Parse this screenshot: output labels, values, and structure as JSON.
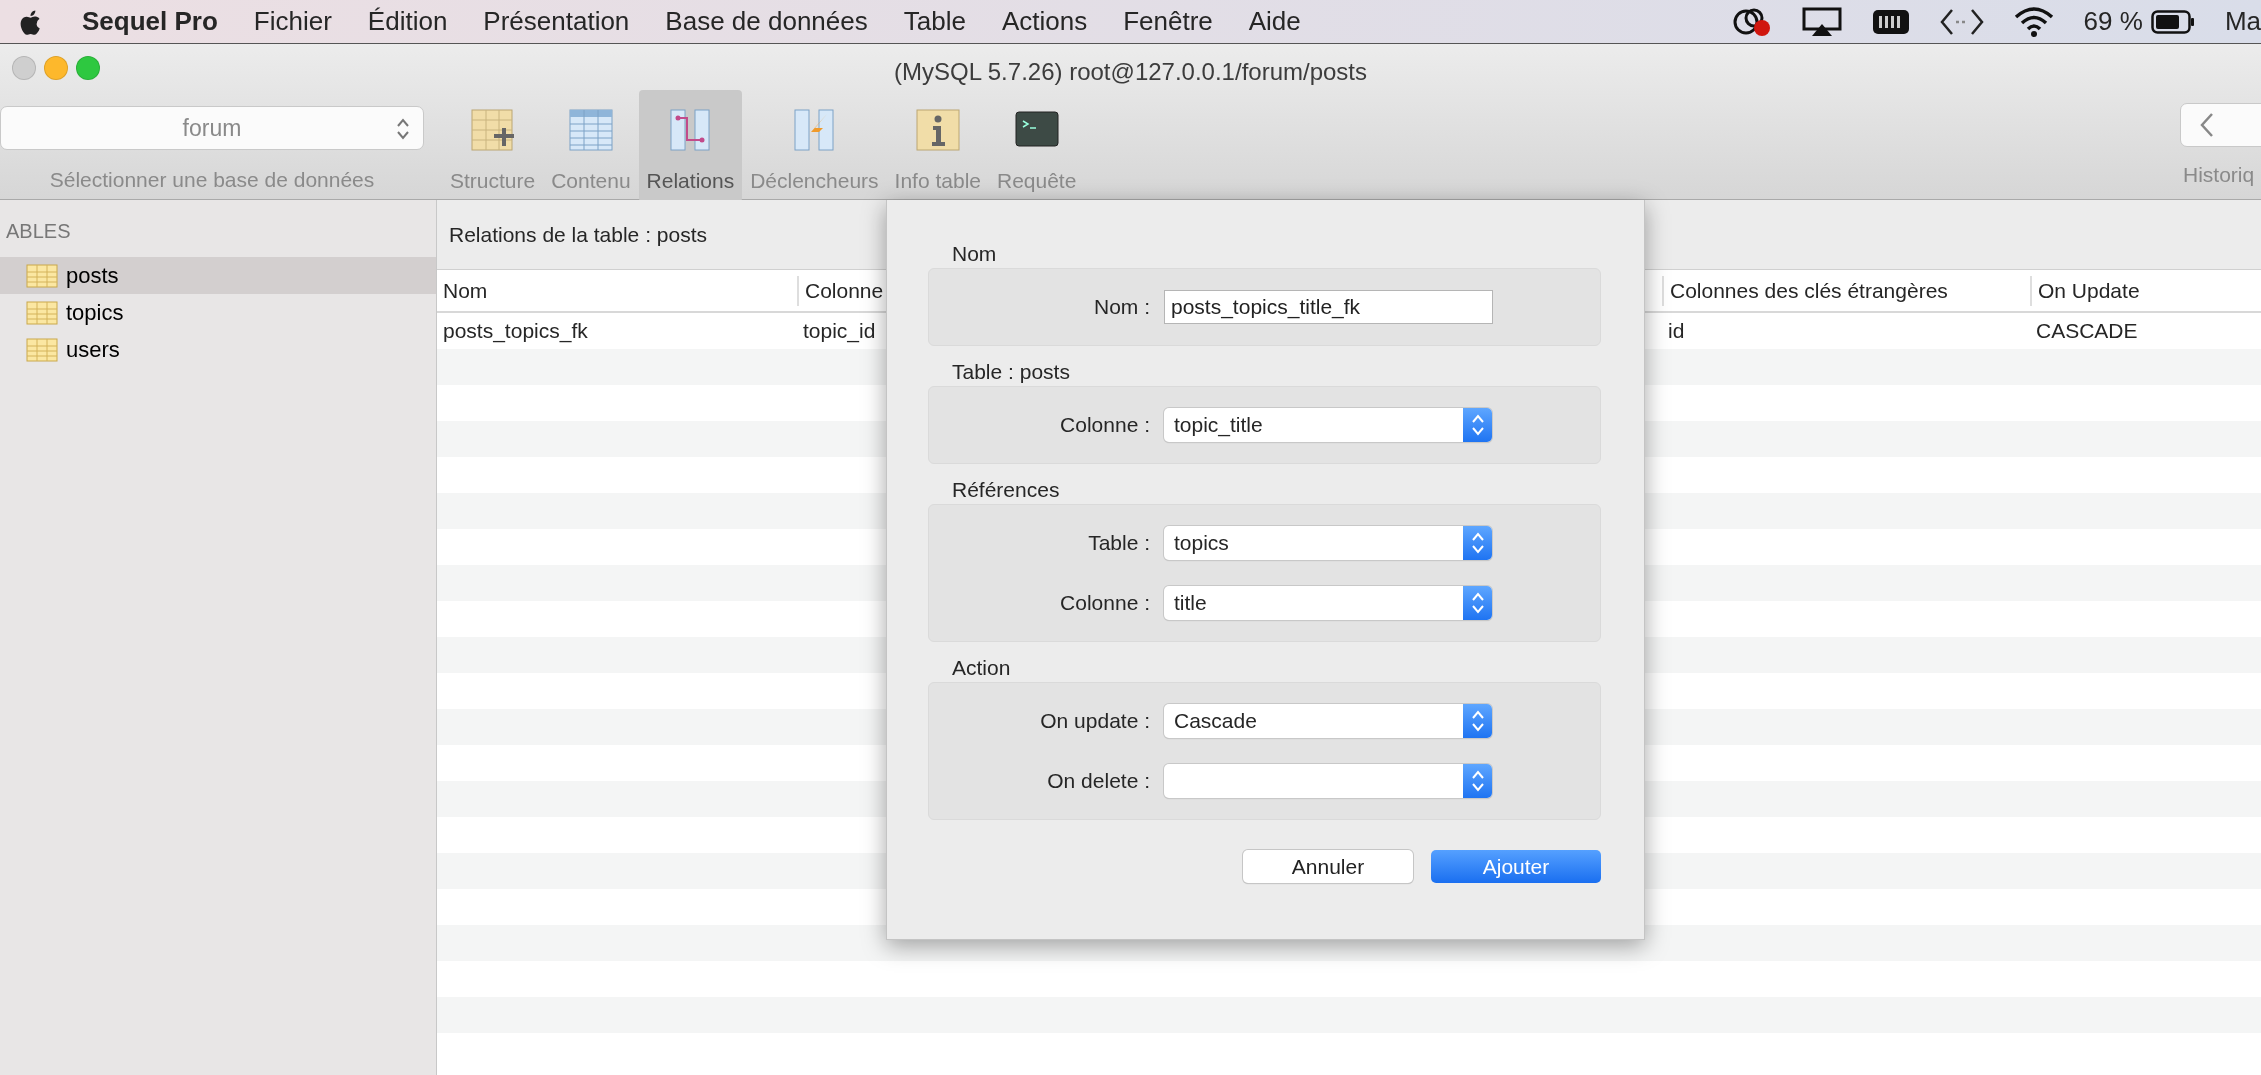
{
  "menu_bar": {
    "app": "Sequel Pro",
    "items": [
      "Fichier",
      "Édition",
      "Présentation",
      "Base de données",
      "Table",
      "Actions",
      "Fenêtre",
      "Aide"
    ],
    "battery": "69 %",
    "clock": "Ma"
  },
  "window": {
    "title": "(MySQL 5.7.26) root@127.0.0.1/forum/posts"
  },
  "toolbar": {
    "database": {
      "value": "forum",
      "label": "Sélectionner une base de données"
    },
    "tabs": [
      {
        "label": "Structure",
        "kind": "structure",
        "selected": false
      },
      {
        "label": "Contenu",
        "kind": "content",
        "selected": false
      },
      {
        "label": "Relations",
        "kind": "relations",
        "selected": true
      },
      {
        "label": "Déclencheurs",
        "kind": "triggers",
        "selected": false
      },
      {
        "label": "Info table",
        "kind": "info",
        "selected": false
      },
      {
        "label": "Requête",
        "kind": "query",
        "selected": false
      }
    ],
    "history_label": "Historiq"
  },
  "sidebar": {
    "heading": "ABLES",
    "items": [
      {
        "label": "posts",
        "selected": true
      },
      {
        "label": "topics",
        "selected": false
      },
      {
        "label": "users",
        "selected": false
      }
    ]
  },
  "relations": {
    "title": "Relations de la table : posts",
    "columns": [
      "Nom",
      "Colonne",
      "Colonnes des clés étrangères",
      "On Update"
    ],
    "rows": [
      [
        "posts_topics_fk",
        "topic_id",
        "id",
        "CASCADE"
      ]
    ]
  },
  "dialog": {
    "sections": [
      {
        "title": "Nom",
        "fields": [
          {
            "kind": "text",
            "label": "Nom :",
            "value": "posts_topics_title_fk"
          }
        ]
      },
      {
        "title": "Table : posts",
        "fields": [
          {
            "kind": "select",
            "label": "Colonne :",
            "value": "topic_title"
          }
        ]
      },
      {
        "title": "Références",
        "fields": [
          {
            "kind": "select",
            "label": "Table :",
            "value": "topics"
          },
          {
            "kind": "select",
            "label": "Colonne :",
            "value": "title"
          }
        ]
      },
      {
        "title": "Action",
        "fields": [
          {
            "kind": "select",
            "label": "On update :",
            "value": "Cascade"
          },
          {
            "kind": "select",
            "label": "On delete :"
          }
        ]
      }
    ],
    "buttons": [
      {
        "label": "Annuler",
        "primary": false
      },
      {
        "label": "Ajouter",
        "primary": true
      }
    ]
  }
}
